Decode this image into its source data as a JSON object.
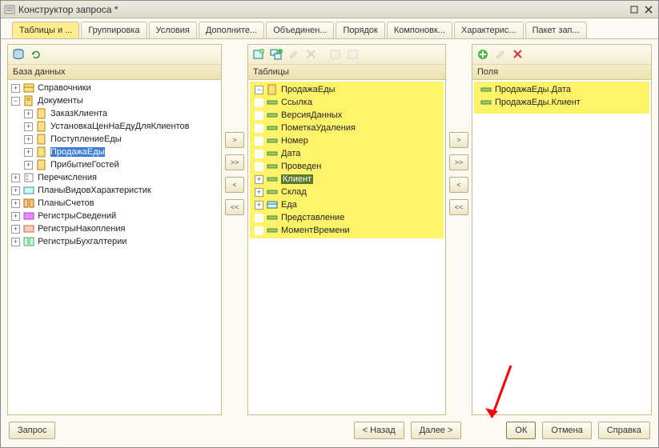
{
  "window": {
    "title": "Конструктор запроса *"
  },
  "tabs": [
    {
      "label": "Таблицы и ...",
      "active": true
    },
    {
      "label": "Группировка"
    },
    {
      "label": "Условия"
    },
    {
      "label": "Дополните..."
    },
    {
      "label": "Объединен..."
    },
    {
      "label": "Порядок"
    },
    {
      "label": "Компоновк..."
    },
    {
      "label": "Характерис..."
    },
    {
      "label": "Пакет зап..."
    }
  ],
  "db": {
    "header": "База данных",
    "items": [
      {
        "label": "Справочники",
        "icon": "catalog",
        "exp": "+"
      },
      {
        "label": "Документы",
        "icon": "doc",
        "exp": "-",
        "children": [
          {
            "label": "ЗаказКлиента",
            "icon": "doc",
            "exp": "+"
          },
          {
            "label": "УстановкаЦенНаЕдуДляКлиентов",
            "icon": "doc",
            "exp": "+"
          },
          {
            "label": "ПоступлениеЕды",
            "icon": "doc",
            "exp": "+"
          },
          {
            "label": "ПродажаЕды",
            "icon": "doc",
            "exp": "+",
            "selected": true
          },
          {
            "label": "ПрибытиеГостей",
            "icon": "doc",
            "exp": "+"
          }
        ]
      },
      {
        "label": "Перечисления",
        "icon": "enum",
        "exp": "+"
      },
      {
        "label": "ПланыВидовХарактеристик",
        "icon": "chartype",
        "exp": "+"
      },
      {
        "label": "ПланыСчетов",
        "icon": "accounts",
        "exp": "+"
      },
      {
        "label": "РегистрыСведений",
        "icon": "inforeg",
        "exp": "+"
      },
      {
        "label": "РегистрыНакопления",
        "icon": "accumreg",
        "exp": "+"
      },
      {
        "label": "РегистрыБухгалтерии",
        "icon": "accreg",
        "exp": "+"
      }
    ]
  },
  "tables": {
    "header": "Таблицы",
    "root": {
      "label": "ПродажаЕды",
      "icon": "doc",
      "exp": "-"
    },
    "fields": [
      {
        "label": "Ссылка",
        "icon": "field"
      },
      {
        "label": "ВерсияДанных",
        "icon": "field"
      },
      {
        "label": "ПометкаУдаления",
        "icon": "field"
      },
      {
        "label": "Номер",
        "icon": "field"
      },
      {
        "label": "Дата",
        "icon": "field"
      },
      {
        "label": "Проведен",
        "icon": "field"
      },
      {
        "label": "Клиент",
        "icon": "field",
        "exp": "+",
        "selected": true
      },
      {
        "label": "Склад",
        "icon": "field",
        "exp": "+"
      },
      {
        "label": "Еда",
        "icon": "table",
        "exp": "+"
      },
      {
        "label": "Представление",
        "icon": "field"
      },
      {
        "label": "МоментВремени",
        "icon": "field"
      }
    ]
  },
  "fields": {
    "header": "Поля",
    "items": [
      {
        "label": "ПродажаЕды.Дата",
        "icon": "field"
      },
      {
        "label": "ПродажаЕды.Клиент",
        "icon": "field"
      }
    ]
  },
  "footer": {
    "query": "Запрос",
    "back": "< Назад",
    "next": "Далее >",
    "ok": "ОК",
    "cancel": "Отмена",
    "help": "Справка"
  }
}
